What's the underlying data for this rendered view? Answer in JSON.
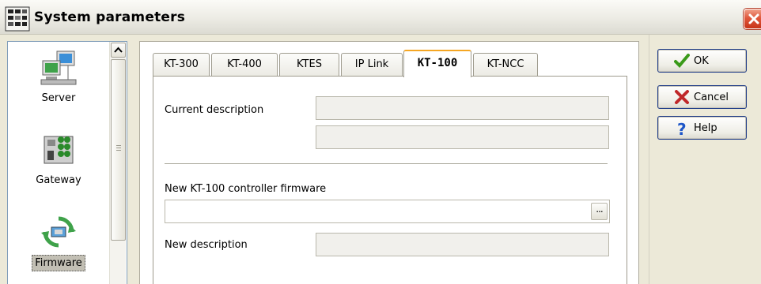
{
  "window": {
    "title": "System parameters",
    "icon": "app-grid-icon",
    "close_icon": "close-icon"
  },
  "nav": {
    "items": [
      {
        "label": "Server",
        "icon": "server-icon"
      },
      {
        "label": "Gateway",
        "icon": "gateway-icon"
      },
      {
        "label": "Firmware",
        "icon": "firmware-icon",
        "selected": true
      }
    ]
  },
  "tabs": {
    "items": [
      "KT-300",
      "KT-400",
      "KTES",
      "IP Link",
      "KT-100",
      "KT-NCC"
    ],
    "active": "KT-100"
  },
  "form": {
    "current_description_label": "Current description",
    "current_description_value_1": "",
    "current_description_value_2": "",
    "new_firmware_label": "New KT-100 controller firmware",
    "new_firmware_value": "",
    "browse_button_label": "...",
    "new_description_label": "New description",
    "new_description_value": ""
  },
  "buttons": {
    "ok": "OK",
    "cancel": "Cancel",
    "help": "Help"
  },
  "colors": {
    "accent_tab": "#f5a623",
    "ok_check": "#3a9a1a",
    "cancel_x": "#c0282a",
    "help_q": "#1e56c8",
    "close": "#e0573b"
  }
}
